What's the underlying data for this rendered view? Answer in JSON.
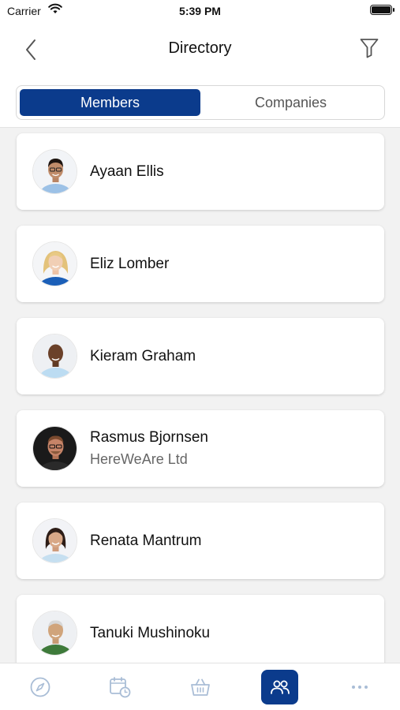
{
  "status_bar": {
    "carrier": "Carrier",
    "time": "5:39 PM"
  },
  "nav": {
    "title": "Directory",
    "back_icon": "chevron-left-icon",
    "filter_icon": "filter-icon"
  },
  "segment": {
    "tabs": [
      "Members",
      "Companies"
    ],
    "selected": "Members"
  },
  "members": [
    {
      "name": "Ayaan Ellis",
      "company": ""
    },
    {
      "name": "Eliz Lomber",
      "company": ""
    },
    {
      "name": "Kieram Graham",
      "company": ""
    },
    {
      "name": "Rasmus Bjornsen",
      "company": "HereWeAre Ltd"
    },
    {
      "name": "Renata Mantrum",
      "company": ""
    },
    {
      "name": "Tanuki Mushinoku",
      "company": ""
    }
  ],
  "tab_bar": {
    "items": [
      "compass-icon",
      "calendar-clock-icon",
      "basket-icon",
      "people-icon",
      "more-icon"
    ],
    "active": "people-icon"
  },
  "colors": {
    "accent": "#0b3b8c",
    "inactive_icon": "#a9bdd6",
    "background": "#f2f2f2"
  }
}
